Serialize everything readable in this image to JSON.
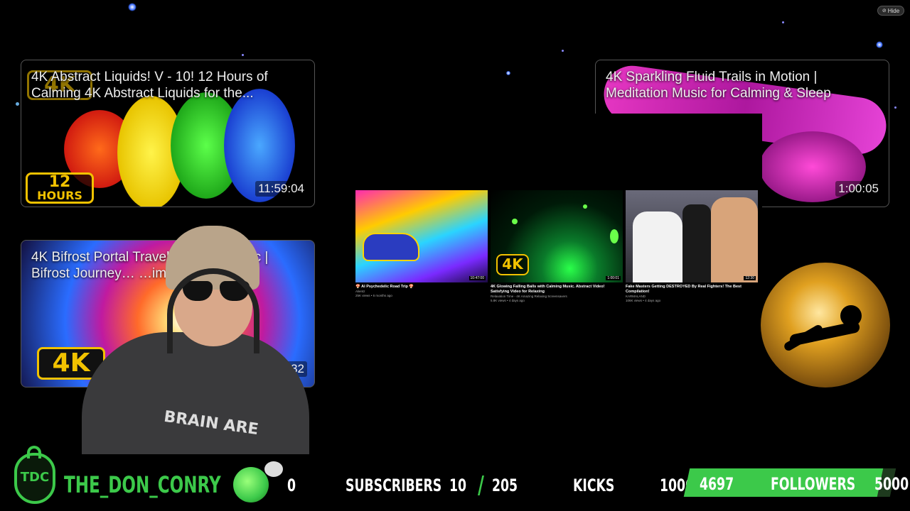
{
  "hide_button": {
    "label": "Hide"
  },
  "videos": [
    {
      "title": "4K Abstract Liquids! V - 10! 12 Hours of Calming 4K Abstract Liquids for the...",
      "duration": "11:59:04",
      "badge_top": "4K",
      "badge_line1": "12",
      "badge_line2": "HOURS"
    },
    {
      "title": "4K Sparkling Fluid Trails in Motion | Meditation Music for Calming & Sleep",
      "duration": "1:00:05"
    },
    {
      "title": "4K Bifrost Portal Travel… …tion Music | Bifrost Journey… …ime...",
      "duration": "…:32",
      "badge": "4K"
    }
  ],
  "thumbs": [
    {
      "title": "🍄 AI Psychedelic Road Trip 🍄",
      "channel": "Alientz",
      "meta": "25K views • 6 months ago",
      "time": "10:47:00"
    },
    {
      "title": "4K Glowing Falling Balls with Calming Music. Abstract Video! Satisfying Video for Relaxing",
      "channel": "Relaxation Time - 4K Amazing Relaxing Screensavers",
      "meta": "5.8K views • 4 days ago",
      "time": "1:00:01",
      "badge": "4K"
    },
    {
      "title": "Fake Masters Getting DESTROYED By Real Fighters! The Best Compilation!",
      "channel": "KARMALAND",
      "meta": "106K views • 4 days ago",
      "time": "12:30"
    }
  ],
  "webcam": {
    "shirt_text": "BRAIN ARE"
  },
  "footer": {
    "logo": "TDC",
    "channel_name": "THE_DON_CONRY",
    "subs_count": "0",
    "subs_label": "SUBSCRIBERS",
    "subs_current": "10",
    "separator": "/",
    "subs_goal": "205",
    "kicks_label": "KICKS",
    "kicks_goal": "10000",
    "followers_current": "4697",
    "followers_label": "FOLLOWERS",
    "followers_goal": "5000",
    "followers_progress": 0.9394
  },
  "colors": {
    "accent_green": "#3cc94a",
    "badge_yellow": "#f2c200"
  }
}
